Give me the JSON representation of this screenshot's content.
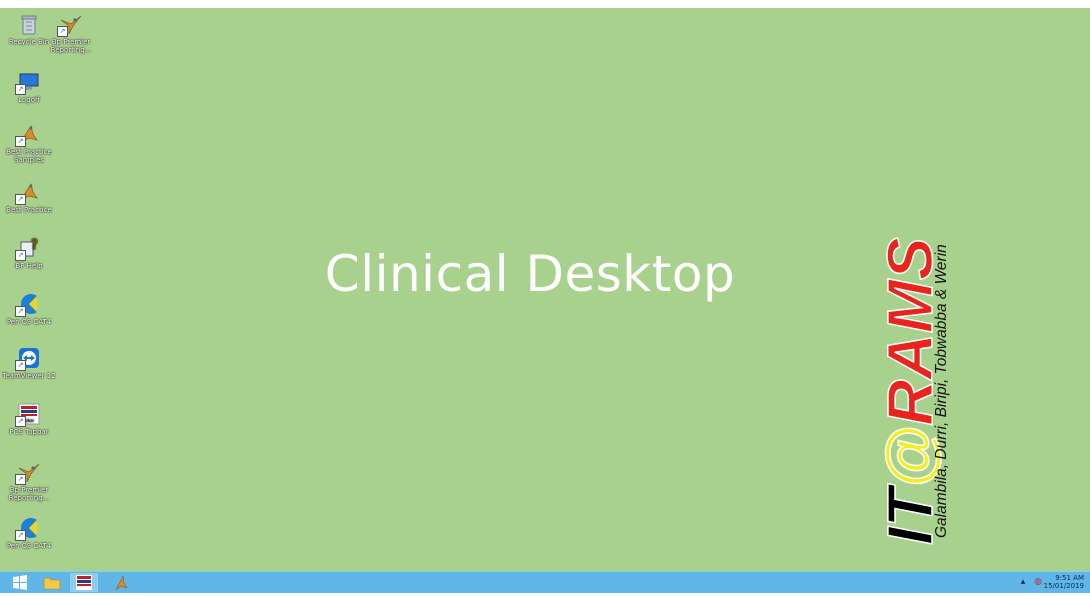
{
  "desktop": {
    "title": "Clinical Desktop",
    "background_color": "#a9d18e"
  },
  "icons": [
    {
      "label": "Recycle Bin",
      "icon": "recycle-bin-icon"
    },
    {
      "label": "Bp Premier Reporting...",
      "icon": "bird-icon"
    },
    {
      "label": "Logoff",
      "icon": "monitor-logoff-icon"
    },
    {
      "label": "Best Practice Samples",
      "icon": "bird-icon"
    },
    {
      "label": "Best Practice",
      "icon": "bird-icon"
    },
    {
      "label": "BP Help",
      "icon": "help-question-icon"
    },
    {
      "label": "Pen CS CAT4",
      "icon": "pen-cs-cat4-icon"
    },
    {
      "label": "TeamViewer 12",
      "icon": "teamviewer-icon"
    },
    {
      "label": "PCS Topbar",
      "icon": "pcs-topbar-icon"
    },
    {
      "label": "Bp Premier Reporting...",
      "icon": "bird-icon"
    },
    {
      "label": "Pen CS CAT4",
      "icon": "pen-cs-cat4-icon"
    }
  ],
  "logo": {
    "brand_it": "IT",
    "brand_at": "@",
    "brand_rams": "RAMS",
    "tagline": "Galambila, Durri, Biripi, Tobwabba & Werin",
    "colors": {
      "it": "#000000",
      "at": "#f2ef1e",
      "rams": "#e8241c",
      "tagline": "#111111"
    }
  },
  "taskbar": {
    "buttons": [
      {
        "name": "start-button",
        "icon": "windows-logo-icon"
      },
      {
        "name": "file-explorer-button",
        "icon": "folder-icon"
      },
      {
        "name": "pcs-topbar-taskbar-button",
        "icon": "pcs-topbar-icon"
      },
      {
        "name": "best-practice-taskbar-button",
        "icon": "bird-icon"
      }
    ],
    "time": "9:51 AM",
    "date": "15/01/2019",
    "color": "#5fb6e7"
  }
}
